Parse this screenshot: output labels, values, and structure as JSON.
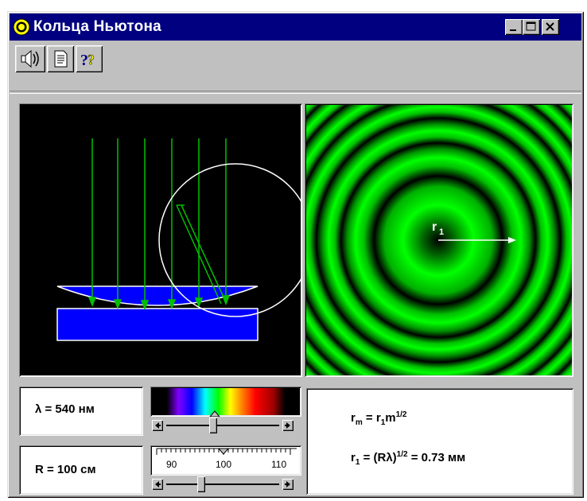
{
  "window": {
    "title": "Кольца Ньютона",
    "controls": [
      "minimize",
      "maximize",
      "close"
    ]
  },
  "toolbar": {
    "buttons": [
      {
        "name": "sound",
        "icon": "speaker-icon"
      },
      {
        "name": "description",
        "icon": "document-icon"
      },
      {
        "name": "help",
        "icon": "help-icon"
      }
    ]
  },
  "colors": {
    "titlebar": "#000080",
    "face": "#c0c0c0",
    "ray": "#00c000",
    "lens": "#0000ff",
    "ring_green": "#00ff00"
  },
  "wavelength": {
    "label": "λ = 540 нм",
    "value_nm": 540
  },
  "radius": {
    "label": "R = 100 см",
    "value_cm": 100,
    "scale": [
      "90",
      "100",
      "110"
    ]
  },
  "rings_view": {
    "radius_label": "r",
    "radius_sub": "1"
  },
  "formulas": {
    "line1": {
      "lhs": "r",
      "lhs_sub": "m",
      "eq": " = r",
      "mid_sub": "1",
      "tail": "m",
      "tail_sup": "1/2"
    },
    "line2": {
      "lhs": "r",
      "lhs_sub": "1",
      "eq": " = (Rλ)",
      "sup": "1/2",
      "tail": " = 0.73 мм"
    }
  }
}
